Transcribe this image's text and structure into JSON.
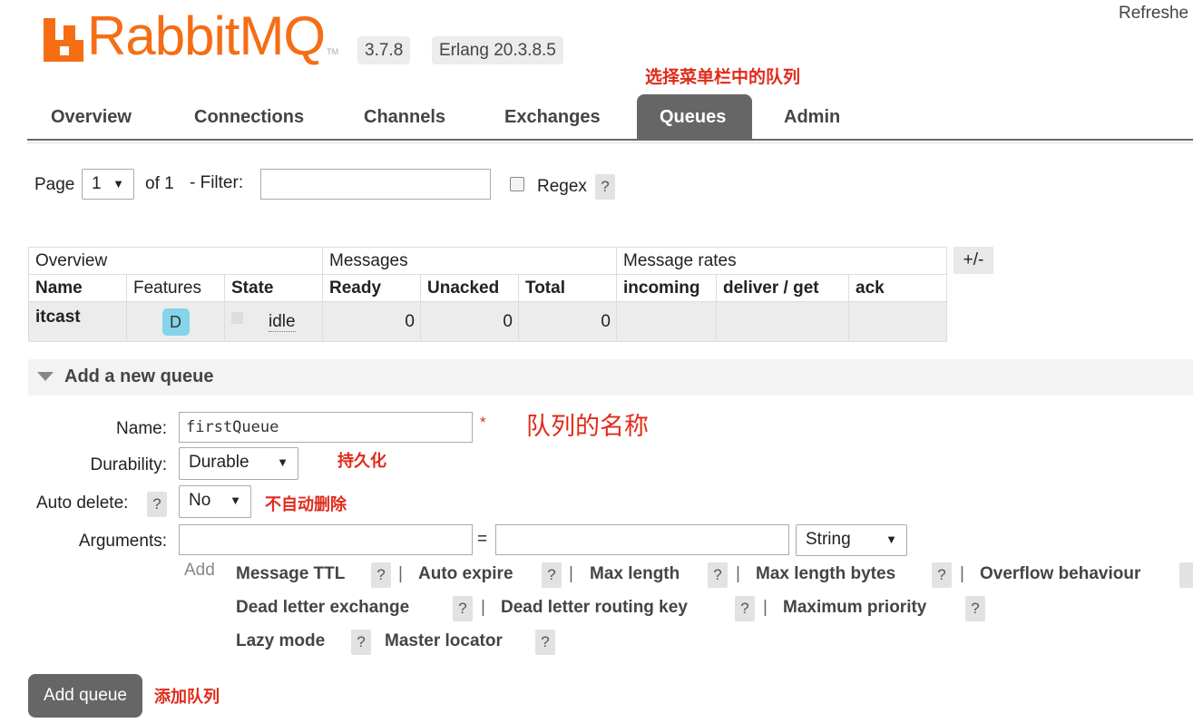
{
  "header": {
    "logo_text": "RabbitMQ",
    "logo_tm": "TM",
    "version": "3.7.8",
    "erlang": "Erlang 20.3.8.5",
    "refreshed": "Refreshe"
  },
  "annotations": {
    "select_queue": "选择菜单栏中的队列",
    "queue_name": "队列的名称",
    "durable": "持久化",
    "no_auto_delete": "不自动删除",
    "add_queue": "添加队列"
  },
  "tabs": [
    {
      "label": "Overview"
    },
    {
      "label": "Connections"
    },
    {
      "label": "Channels"
    },
    {
      "label": "Exchanges"
    },
    {
      "label": "Queues",
      "active": true
    },
    {
      "label": "Admin"
    }
  ],
  "paging": {
    "page_label": "Page",
    "page_value": "1",
    "of_label": "of 1",
    "filter_label": "- Filter:",
    "regex_label": "Regex",
    "help": "?"
  },
  "table": {
    "group_headers": [
      "Overview",
      "Messages",
      "Message rates"
    ],
    "columns": [
      "Name",
      "Features",
      "State",
      "Ready",
      "Unacked",
      "Total",
      "incoming",
      "deliver / get",
      "ack"
    ],
    "rows": [
      {
        "name": "itcast",
        "feature": "D",
        "state": "idle",
        "ready": "0",
        "unacked": "0",
        "total": "0"
      }
    ],
    "toggle": "+/-"
  },
  "add_queue": {
    "section_title": "Add a new queue",
    "name_label": "Name:",
    "name_value": "firstQueue",
    "required_mark": "*",
    "durability_label": "Durability:",
    "durability_value": "Durable",
    "auto_delete_label": "Auto delete:",
    "auto_delete_value": "No",
    "arguments_label": "Arguments:",
    "equals": "=",
    "type_value": "String",
    "add_label": "Add",
    "argument_tags": [
      "Message TTL",
      "Auto expire",
      "Max length",
      "Max length bytes",
      "Overflow behaviour",
      "Dead letter exchange",
      "Dead letter routing key",
      "Maximum priority",
      "Lazy mode",
      "Master locator"
    ],
    "separator": "|",
    "button": "Add queue"
  },
  "colors": {
    "brand": "#f56e14",
    "tab_active": "#666666",
    "annotation": "#e12a1a",
    "durable_badge": "#84d4ea"
  }
}
